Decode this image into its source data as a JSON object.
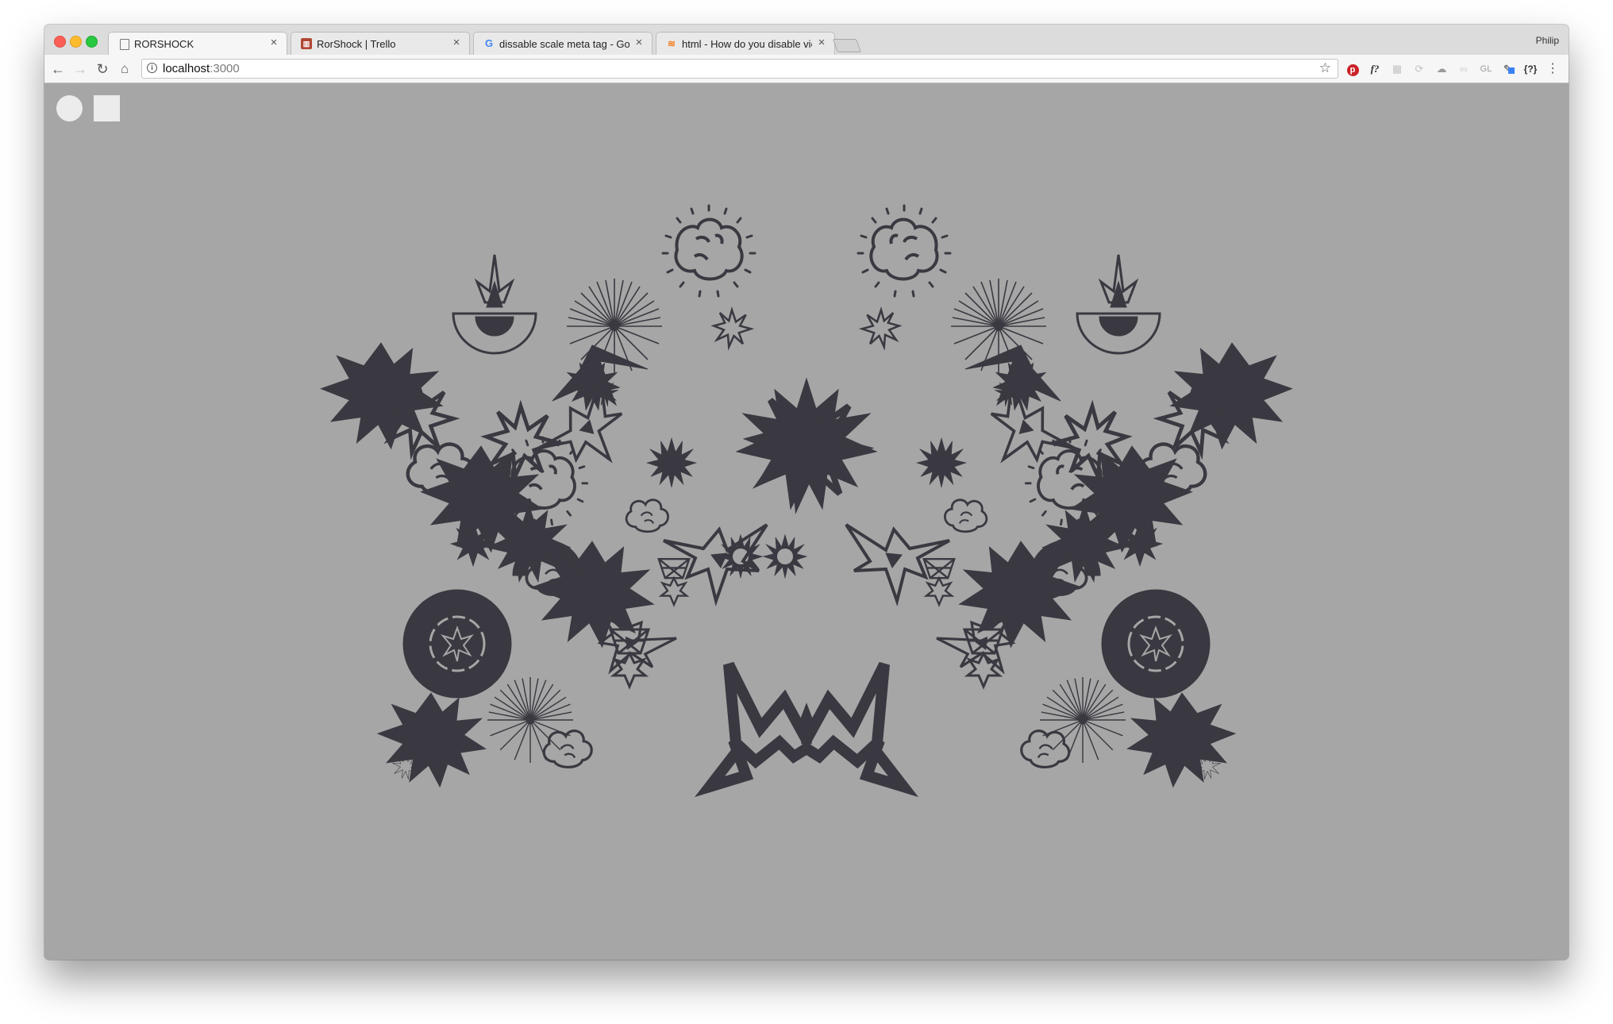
{
  "window": {
    "profile_name": "Philip"
  },
  "tabs": [
    {
      "title": "RORSHOCK",
      "icon": "document-icon",
      "active": true
    },
    {
      "title": "RorShock | Trello",
      "icon": "trello-icon",
      "active": false
    },
    {
      "title": "dissable scale meta tag - Goog",
      "icon": "google-icon",
      "active": false
    },
    {
      "title": "html - How do you disable vie",
      "icon": "stackoverflow-icon",
      "active": false
    }
  ],
  "toolbar": {
    "url_host": "localhost",
    "url_port": ":3000",
    "extensions": [
      "pinterest-icon",
      "fontface-ninja-icon",
      "grid-icon",
      "refresh-ext-icon",
      "cloud-icon",
      "ex-icon",
      "gl-icon",
      "eyedropper-icon",
      "json-icon"
    ]
  },
  "controls": {
    "circle_button": "circle-shape-button",
    "square_button": "square-shape-button"
  },
  "colors": {
    "canvas_background": "#a6a6a6",
    "ink": "#3a3941",
    "control_fill": "#ececec"
  }
}
